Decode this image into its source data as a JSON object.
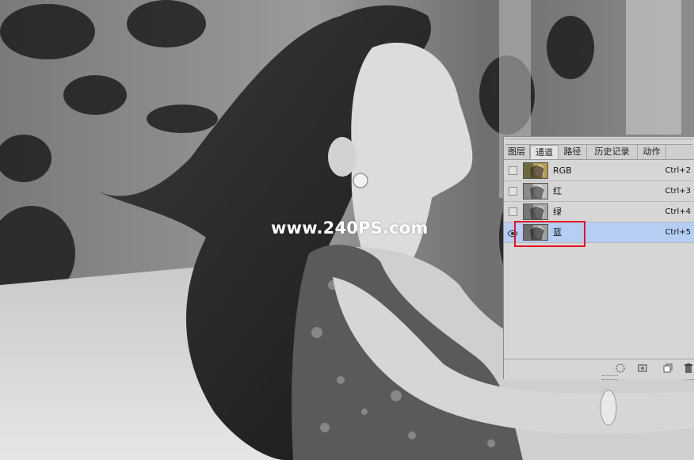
{
  "watermark": "www.240PS.com",
  "channels_panel": {
    "tabs": [
      "图层",
      "通道",
      "路径",
      "历史记录",
      "动作"
    ],
    "active_tab": "通道",
    "channels": [
      {
        "name": "RGB",
        "shortcut": "Ctrl+2",
        "visible": false,
        "selected": false,
        "thumb": "color"
      },
      {
        "name": "红",
        "shortcut": "Ctrl+3",
        "visible": false,
        "selected": false,
        "thumb": "gray-light"
      },
      {
        "name": "绿",
        "shortcut": "Ctrl+4",
        "visible": false,
        "selected": false,
        "thumb": "gray"
      },
      {
        "name": "蓝",
        "shortcut": "Ctrl+5",
        "visible": true,
        "selected": true,
        "thumb": "gray-dark"
      }
    ],
    "bottom_icons": [
      "load-selection-icon",
      "save-selection-icon",
      "new-channel-icon",
      "delete-channel-icon"
    ]
  },
  "colors": {
    "selection_highlight": "#b6cdf4",
    "annotation_box": "#e3141c"
  }
}
